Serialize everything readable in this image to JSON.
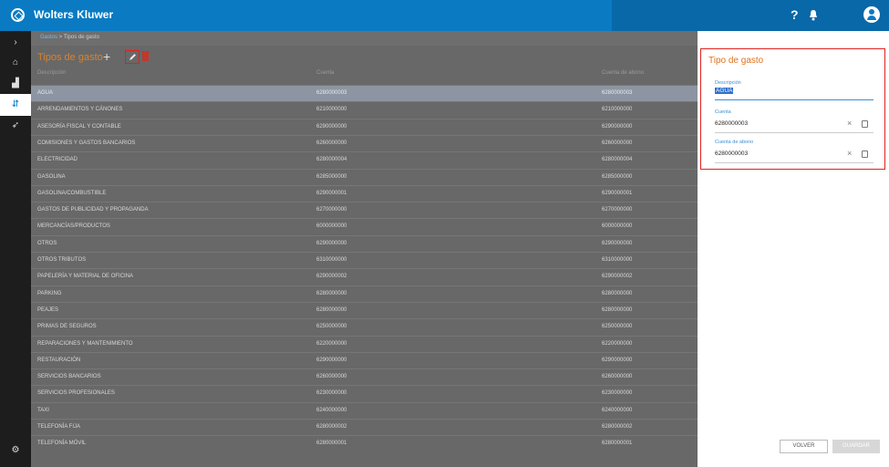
{
  "app": {
    "brand": "Wolters Kluwer",
    "help_label": "?"
  },
  "nav": {
    "items": [
      {
        "name": "collapse",
        "glyph": "›"
      },
      {
        "name": "home",
        "glyph": "⌂"
      },
      {
        "name": "reports",
        "glyph": "▟"
      },
      {
        "name": "expenses",
        "glyph": "⇵"
      },
      {
        "name": "rocket",
        "glyph": "➶"
      },
      {
        "name": "settings",
        "glyph": "⚙"
      }
    ]
  },
  "breadcrumb": {
    "parent": "Gastos",
    "sep": ">",
    "current": "Tipos de gasto"
  },
  "list": {
    "title": "Tipos de gasto",
    "add_label": "+",
    "columns": [
      "Descripción",
      "Cuenta",
      "Cuenta de abono"
    ],
    "rows": [
      [
        "AGUA",
        "6280000003",
        "6280000003"
      ],
      [
        "ARRENDAMIENTOS Y CÁNONES",
        "6210000000",
        "6210000000"
      ],
      [
        "ASESORÍA FISCAL Y CONTABLE",
        "6290000000",
        "6290000000"
      ],
      [
        "COMISIONES Y GASTOS BANCARIOS",
        "6260000000",
        "6260000000"
      ],
      [
        "ELECTRICIDAD",
        "6280000004",
        "6280000004"
      ],
      [
        "GASOLINA",
        "6285000000",
        "6285000000"
      ],
      [
        "GASOLINA/COMBUSTIBLE",
        "6290000001",
        "6290000001"
      ],
      [
        "GASTOS DE PUBLICIDAD Y PROPAGANDA",
        "6270000000",
        "6270000000"
      ],
      [
        "MERCANCÍAS/PRODUCTOS",
        "6000000000",
        "6000000000"
      ],
      [
        "OTROS",
        "6290000000",
        "6290000000"
      ],
      [
        "OTROS TRIBUTOS",
        "6310000000",
        "6310000000"
      ],
      [
        "PAPELERÍA Y MATERIAL DE OFICINA",
        "6290000002",
        "6290000002"
      ],
      [
        "PARKING",
        "6280000000",
        "6280000000"
      ],
      [
        "PEAJES",
        "6280000000",
        "6280000000"
      ],
      [
        "PRIMAS DE SEGUROS",
        "6250000000",
        "6250000000"
      ],
      [
        "REPARACIONES Y MANTENIMIENTO",
        "6220000000",
        "6220000000"
      ],
      [
        "RESTAURACIÓN",
        "6290000000",
        "6290000000"
      ],
      [
        "SERVICIOS BANCARIOS",
        "6260000000",
        "6260000000"
      ],
      [
        "SERVICIOS PROFESIONALES",
        "6230000000",
        "6230000000"
      ],
      [
        "TAXI",
        "6240000000",
        "6240000000"
      ],
      [
        "TELEFONÍA FIJA",
        "6280000002",
        "6280000002"
      ],
      [
        "TELEFONÍA MÓVIL",
        "6280000001",
        "6280000001"
      ]
    ],
    "selected_row": 0
  },
  "panel": {
    "title": "Tipo de gasto",
    "description_label": "Descripción",
    "description_value": "AGUA",
    "account_label": "Cuenta",
    "account_value": "6280000003",
    "credit_label": "Cuenta de abono",
    "credit_value": "6280000003",
    "clear_glyph": "×"
  },
  "buttons": {
    "back": "VOLVER",
    "save": "GUARDAR"
  },
  "colors": {
    "brand": "#0a7bc2",
    "accent": "#e0731d",
    "highlight": "#e0201e"
  }
}
